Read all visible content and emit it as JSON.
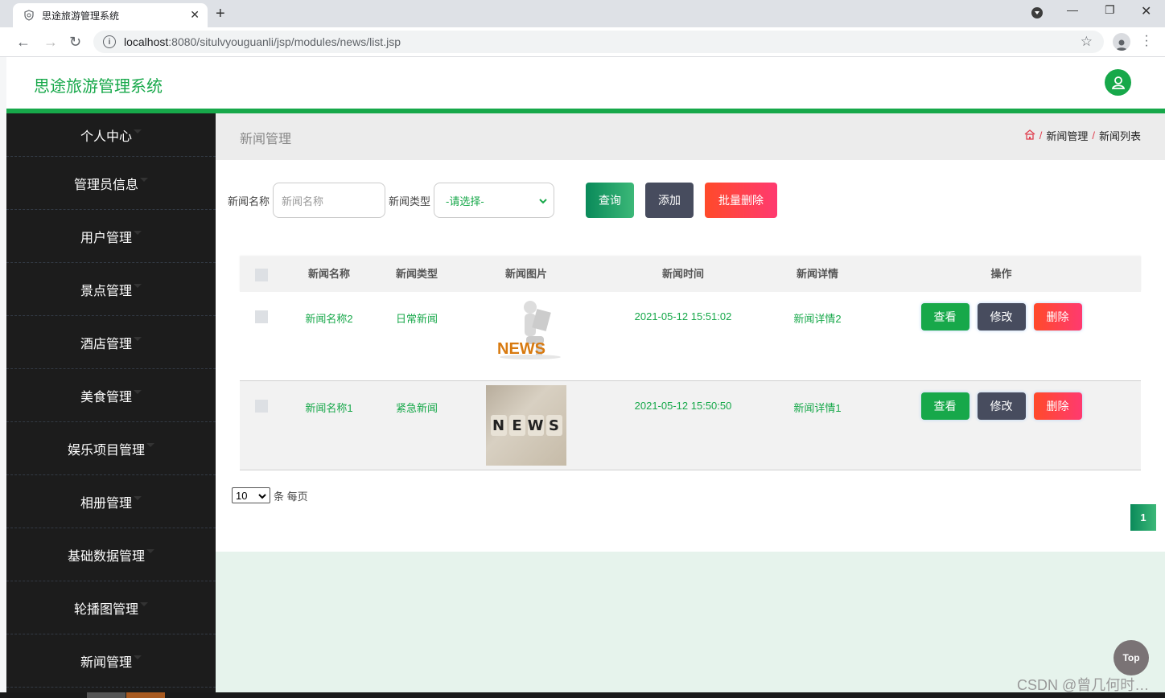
{
  "browser": {
    "tab_title": "思途旅游管理系统",
    "url_host": "localhost",
    "url_path": ":8080/situlvyouguanli/jsp/modules/news/list.jsp"
  },
  "app": {
    "title": "思途旅游管理系统",
    "accent": "#17a84a"
  },
  "sidebar": {
    "items": [
      {
        "label": "个人中心"
      },
      {
        "label": "管理员信息"
      },
      {
        "label": "用户管理"
      },
      {
        "label": "景点管理"
      },
      {
        "label": "酒店管理"
      },
      {
        "label": "美食管理"
      },
      {
        "label": "娱乐项目管理"
      },
      {
        "label": "相册管理"
      },
      {
        "label": "基础数据管理"
      },
      {
        "label": "轮播图管理"
      },
      {
        "label": "新闻管理"
      }
    ]
  },
  "page": {
    "title": "新闻管理",
    "breadcrumb": [
      "新闻管理",
      "新闻列表"
    ]
  },
  "search": {
    "name_label": "新闻名称",
    "name_placeholder": "新闻名称",
    "type_label": "新闻类型",
    "type_selected": "-请选择-",
    "query_button": "查询",
    "add_button": "添加",
    "batch_delete_button": "批量删除"
  },
  "table": {
    "headers": [
      "新闻名称",
      "新闻类型",
      "新闻图片",
      "新闻时间",
      "新闻详情",
      "操作"
    ],
    "rows": [
      {
        "name": "新闻名称2",
        "type": "日常新闻",
        "image": "news-figure-image",
        "time": "2021-05-12 15:51:02",
        "detail": "新闻详情2"
      },
      {
        "name": "新闻名称1",
        "type": "紧急新闻",
        "image": "news-dice-image",
        "time": "2021-05-12 15:50:50",
        "detail": "新闻详情1"
      }
    ],
    "actions": {
      "view": "查看",
      "edit": "修改",
      "delete": "删除"
    }
  },
  "pagination": {
    "page_size": "10",
    "page_size_suffix": "条 每页",
    "current_page": "1"
  },
  "misc": {
    "top_button": "Top",
    "watermark": "CSDN @曾几何时…"
  }
}
